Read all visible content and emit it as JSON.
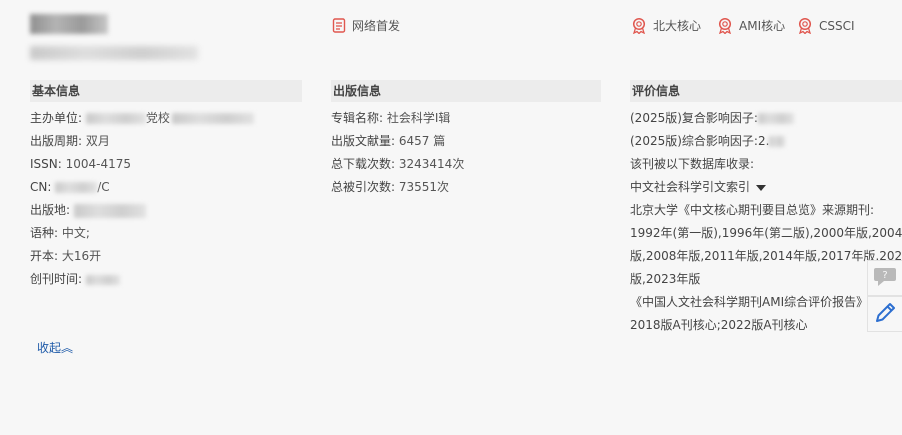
{
  "header": {
    "badges": {
      "first_pub": "网络首发",
      "pku": "北大核心",
      "ami": "AMI核心",
      "cssci": "CSSCI"
    }
  },
  "basic": {
    "heading": "基本信息",
    "sponsor_label": "主办单位:",
    "sponsor_text": "党校",
    "cycle_label": "出版周期:",
    "cycle_value": "双月",
    "issn_label": "ISSN:",
    "issn_value": "1004-4175",
    "cn_label": "CN:",
    "cn_value": "/C",
    "place_label": "出版地:",
    "lang_label": "语种:",
    "lang_value": "中文;",
    "format_label": "开本:",
    "format_value": "大16开",
    "founded_label": "创刊时间:"
  },
  "publication": {
    "heading": "出版信息",
    "series_label": "专辑名称:",
    "series_value": "社会科学Ⅰ辑",
    "count_label": "出版文献量:",
    "count_value": "6457 篇",
    "downloads_label": "总下载次数:",
    "downloads_value": "3243414次",
    "citations_label": "总被引次数:",
    "citations_value": "73551次"
  },
  "evaluation": {
    "heading": "评价信息",
    "composite_if": "(2025版)复合影响因子:",
    "overall_if": "(2025版)综合影响因子:",
    "overall_if_partial": "2.",
    "indexed_by": "该刊被以下数据库收录:",
    "db_dropdown": "中文社会科学引文索引",
    "pku_source": "北京大学《中文核心期刊要目总览》来源期刊:",
    "pku_years_1": "1992年(第一版),1996年(第二版),2000年版,2004年",
    "pku_years_2": "版,2008年版,2011年版,2014年版,2017年版,2020年",
    "pku_years_3": "版,2023年版",
    "ami_report": "《中国人文社会科学期刊AMI综合评价报告》:",
    "ami_years": "2018版A刊核心;2022版A刊核心"
  },
  "collapse_label": "收起︽",
  "colors": {
    "accent_red": "#e0574f",
    "link_blue": "#1e5aa8",
    "pencil_blue": "#2d6fd0"
  },
  "icons": [
    "document-icon",
    "award-icon",
    "comment-icon",
    "pencil-icon"
  ]
}
